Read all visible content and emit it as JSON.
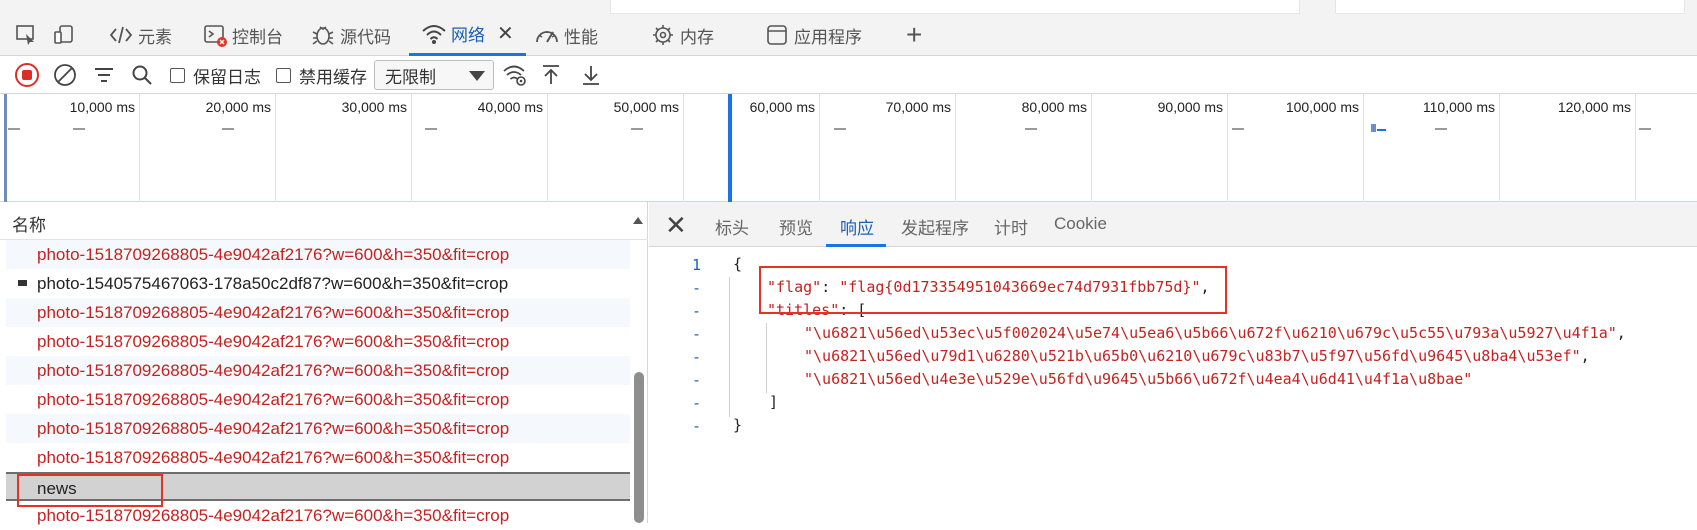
{
  "devtools_tabs": [
    {
      "label": "元素",
      "icon": "code-icon"
    },
    {
      "label": "控制台",
      "icon": "console-icon"
    },
    {
      "label": "源代码",
      "icon": "bug-icon"
    },
    {
      "label": "网络",
      "icon": "wifi-icon"
    },
    {
      "label": "性能",
      "icon": "gauge-icon"
    },
    {
      "label": "内存",
      "icon": "chip-icon"
    },
    {
      "label": "应用程序",
      "icon": "app-icon"
    }
  ],
  "toolbar": {
    "preserve_log": "保留日志",
    "disable_cache": "禁用缓存",
    "throttle": "无限制"
  },
  "overview": {
    "ticks": [
      "10,000 ms",
      "20,000 ms",
      "30,000 ms",
      "40,000 ms",
      "50,000 ms",
      "60,000 ms",
      "70,000 ms",
      "80,000 ms",
      "90,000 ms",
      "100,000 ms",
      "110,000 ms",
      "120,000 ms"
    ]
  },
  "request_list": {
    "header": "名称",
    "rows": [
      {
        "name": "photo-1518709268805-4e9042af2176?w=600&h=350&fit=crop",
        "status": "error"
      },
      {
        "name": "photo-1540575467063-178a50c2df87?w=600&h=350&fit=crop",
        "status": "ok"
      },
      {
        "name": "photo-1518709268805-4e9042af2176?w=600&h=350&fit=crop",
        "status": "error"
      },
      {
        "name": "photo-1518709268805-4e9042af2176?w=600&h=350&fit=crop",
        "status": "error"
      },
      {
        "name": "photo-1518709268805-4e9042af2176?w=600&h=350&fit=crop",
        "status": "error"
      },
      {
        "name": "photo-1518709268805-4e9042af2176?w=600&h=350&fit=crop",
        "status": "error"
      },
      {
        "name": "photo-1518709268805-4e9042af2176?w=600&h=350&fit=crop",
        "status": "error"
      },
      {
        "name": "photo-1518709268805-4e9042af2176?w=600&h=350&fit=crop",
        "status": "error"
      },
      {
        "name": "news",
        "status": "selected"
      },
      {
        "name": "photo-1518709268805-4e9042af2176?w=600&h=350&fit=crop",
        "status": "error"
      }
    ]
  },
  "detail_tabs": [
    "标头",
    "预览",
    "响应",
    "发起程序",
    "计时",
    "Cookie"
  ],
  "response": {
    "line_number": "1",
    "open_brace": "{",
    "flag_key": "\"flag\"",
    "flag_value": "\"flag{0d173354951043669ec74d7931fbb75d}\"",
    "titles_key": "\"titles\"",
    "titles": [
      "\"\\u6821\\u56ed\\u53ec\\u5f002024\\u5e74\\u5ea6\\u5b66\\u672f\\u6210\\u679c\\u5c55\\u793a\\u5927\\u4f1a\"",
      "\"\\u6821\\u56ed\\u79d1\\u6280\\u521b\\u65b0\\u6210\\u679c\\u83b7\\u5f97\\u56fd\\u9645\\u8ba4\\u53ef\"",
      "\"\\u6821\\u56ed\\u4e3e\\u529e\\u56fd\\u9645\\u5b66\\u672f\\u4ea4\\u6d41\\u4f1a\\u8bae\""
    ],
    "close_bracket": "]",
    "close_brace": "}"
  },
  "colors": {
    "accent": "#1a73e8",
    "error_text": "#c5221f",
    "highlight_box": "#e53224"
  }
}
